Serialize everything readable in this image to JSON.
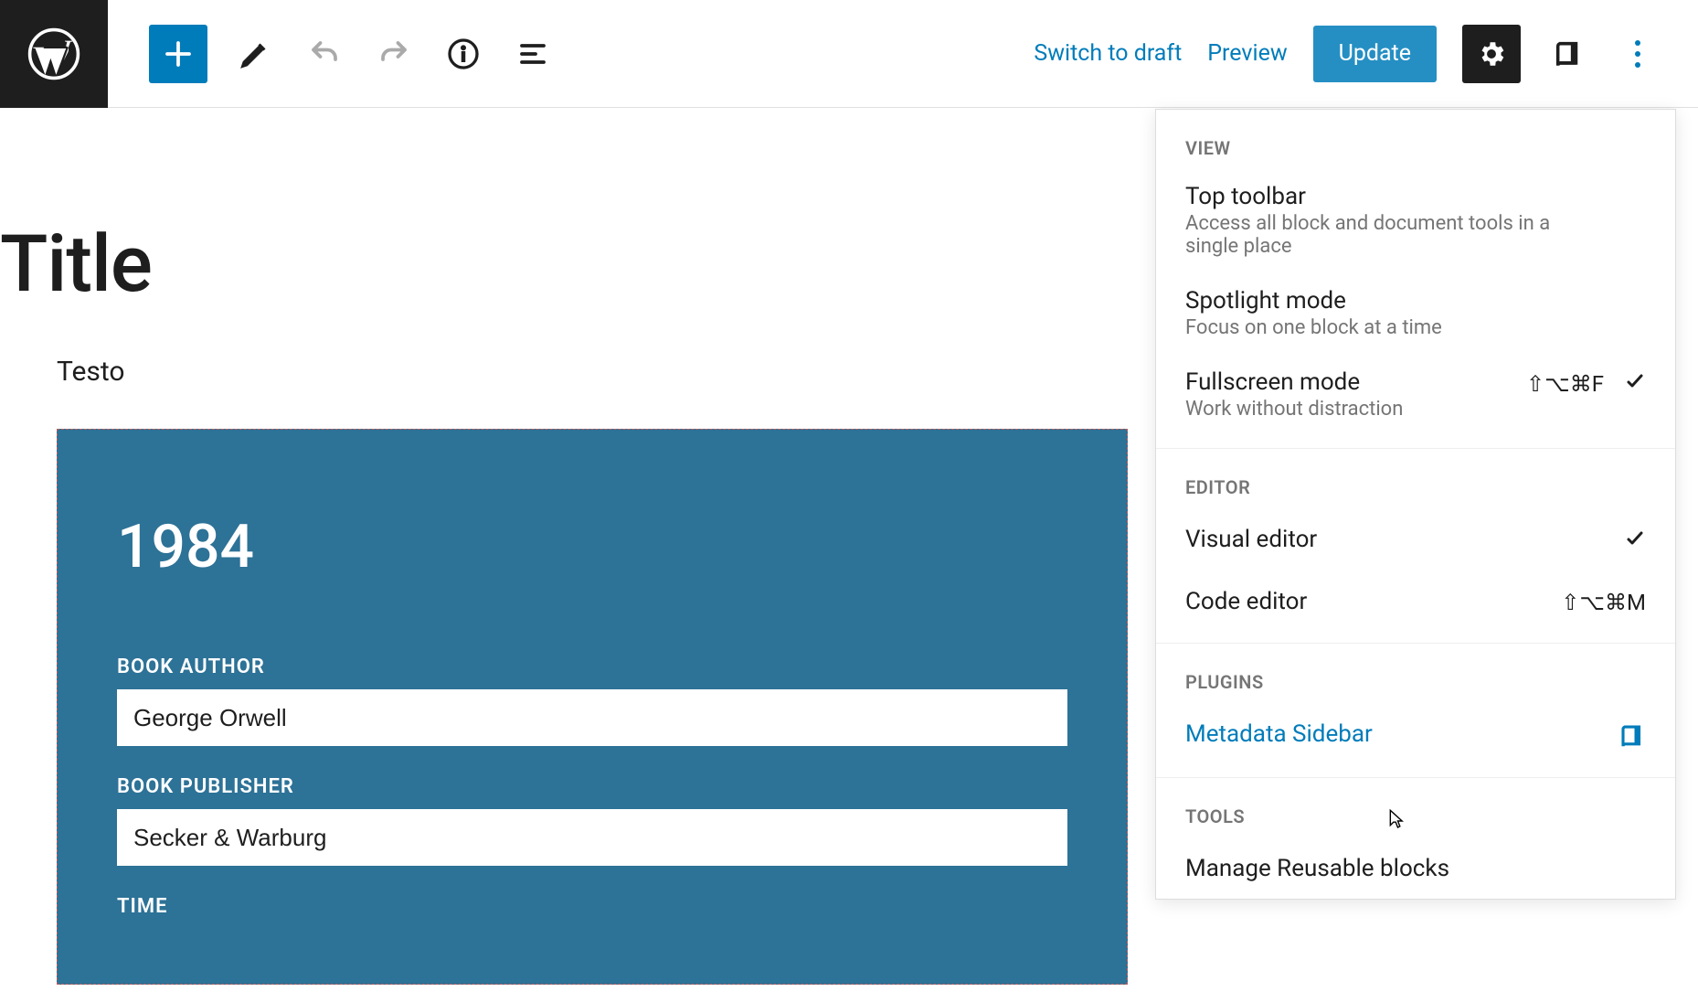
{
  "toolbar": {
    "switch_to_draft": "Switch to draft",
    "preview": "Preview",
    "update": "Update"
  },
  "editor": {
    "title": "Title",
    "paragraph": "Testo",
    "block": {
      "heading": "1984",
      "author_label": "BOOK AUTHOR",
      "author_value": "George Orwell",
      "publisher_label": "BOOK PUBLISHER",
      "publisher_value": "Secker & Warburg",
      "time_label": "TIME"
    }
  },
  "menu": {
    "view_header": "VIEW",
    "top_toolbar": {
      "title": "Top toolbar",
      "sub": "Access all block and document tools in a single place"
    },
    "spotlight": {
      "title": "Spotlight mode",
      "sub": "Focus on one block at a time"
    },
    "fullscreen": {
      "title": "Fullscreen mode",
      "sub": "Work without distraction",
      "shortcut": "⇧⌥⌘F"
    },
    "editor_header": "EDITOR",
    "visual_editor": "Visual editor",
    "code_editor": "Code editor",
    "code_shortcut": "⇧⌥⌘M",
    "plugins_header": "PLUGINS",
    "metadata_sidebar": "Metadata Sidebar",
    "tools_header": "TOOLS",
    "manage_reusable": "Manage Reusable blocks"
  }
}
